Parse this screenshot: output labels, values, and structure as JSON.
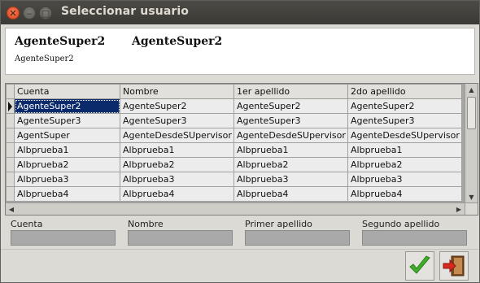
{
  "window": {
    "title": "Seleccionar usuario"
  },
  "header": {
    "name_left": "AgenteSuper2",
    "name_right": "AgenteSuper2",
    "subtitle": "AgenteSuper2"
  },
  "grid": {
    "columns": [
      "Cuenta",
      "Nombre",
      "1er apellido",
      "2do apellido"
    ],
    "rows": [
      [
        "AgenteSuper2",
        "AgenteSuper2",
        "AgenteSuper2",
        "AgenteSuper2"
      ],
      [
        "AgenteSuper3",
        "AgenteSuper3",
        "AgenteSuper3",
        "AgenteSuper3"
      ],
      [
        "AgentSuper",
        "AgenteDesdeSUpervisor",
        "AgenteDesdeSUpervisor",
        "AgenteDesdeSUpervisor"
      ],
      [
        "Albprueba1",
        "Albprueba1",
        "Albprueba1",
        "Albprueba1"
      ],
      [
        "Albprueba2",
        "Albprueba2",
        "Albprueba2",
        "Albprueba2"
      ],
      [
        "Albprueba3",
        "Albprueba3",
        "Albprueba3",
        "Albprueba3"
      ],
      [
        "Albprueba4",
        "Albprueba4",
        "Albprueba4",
        "Albprueba4"
      ]
    ],
    "selected_row": 0
  },
  "filters": {
    "cuenta_label": "Cuenta",
    "nombre_label": "Nombre",
    "primer_apellido_label": "Primer apellido",
    "segundo_apellido_label": "Segundo apellido",
    "cuenta_value": "",
    "nombre_value": "",
    "primer_apellido_value": "",
    "segundo_apellido_value": ""
  },
  "icons": {
    "close": "close-icon",
    "minimize": "minimize-icon",
    "maximize": "maximize-icon",
    "ok": "checkmark-icon",
    "exit": "exit-door-icon"
  },
  "colors": {
    "title_bar": "#3d3c38",
    "selection": "#0b2a6b",
    "close_button": "#e2572d",
    "checkmark": "#3fae2a",
    "exit_arrow": "#d62a1e"
  }
}
